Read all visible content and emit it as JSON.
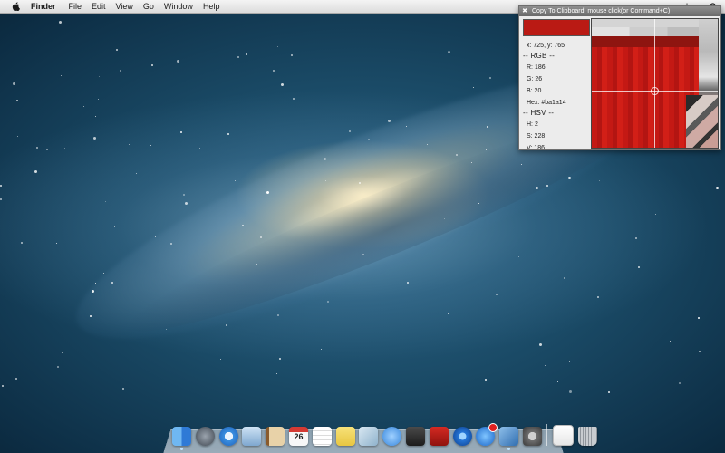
{
  "menubar": {
    "apple_icon": "apple-icon",
    "app_name": "Finder",
    "items": [
      "File",
      "Edit",
      "View",
      "Go",
      "Window",
      "Help"
    ],
    "user": "psward",
    "spotlight_icon": "spotlight-icon"
  },
  "picker": {
    "title": "Copy To Clipboard: mouse click(or Command+C)",
    "close_icon": "close-icon",
    "swatch_color": "#ba1a14",
    "coords": "x: 725, y: 765",
    "rgb_header": "-- RGB --",
    "r": "R: 186",
    "g": "G: 26",
    "b": "B: 20",
    "hex": "Hex: #ba1a14",
    "hsv_header": "-- HSV --",
    "h": "H: 2",
    "s": "S: 228",
    "v": "V: 186"
  },
  "dock": {
    "items": [
      {
        "name": "finder-icon",
        "running": true
      },
      {
        "name": "launchpad-icon",
        "running": false
      },
      {
        "name": "safari-icon",
        "running": false
      },
      {
        "name": "mail-icon",
        "running": false
      },
      {
        "name": "contacts-icon",
        "running": false
      },
      {
        "name": "calendar-icon",
        "running": false,
        "label": "26"
      },
      {
        "name": "reminders-icon",
        "running": false
      },
      {
        "name": "notes-icon",
        "running": false
      },
      {
        "name": "preview-icon",
        "running": false
      },
      {
        "name": "messages-icon",
        "running": false
      },
      {
        "name": "facetime-icon",
        "running": false
      },
      {
        "name": "photo-booth-icon",
        "running": false
      },
      {
        "name": "itunes-icon",
        "running": false
      },
      {
        "name": "app-store-icon",
        "running": false
      },
      {
        "name": "xcode-icon",
        "running": true
      },
      {
        "name": "system-preferences-icon",
        "running": false
      },
      {
        "name": "documents-stack-icon",
        "running": false
      },
      {
        "name": "trash-icon",
        "running": false
      }
    ]
  },
  "colors": {
    "accent": "#ba1a14",
    "menubar_bg": "#e8e8e8",
    "desktop_blue": "#1a4a66"
  }
}
